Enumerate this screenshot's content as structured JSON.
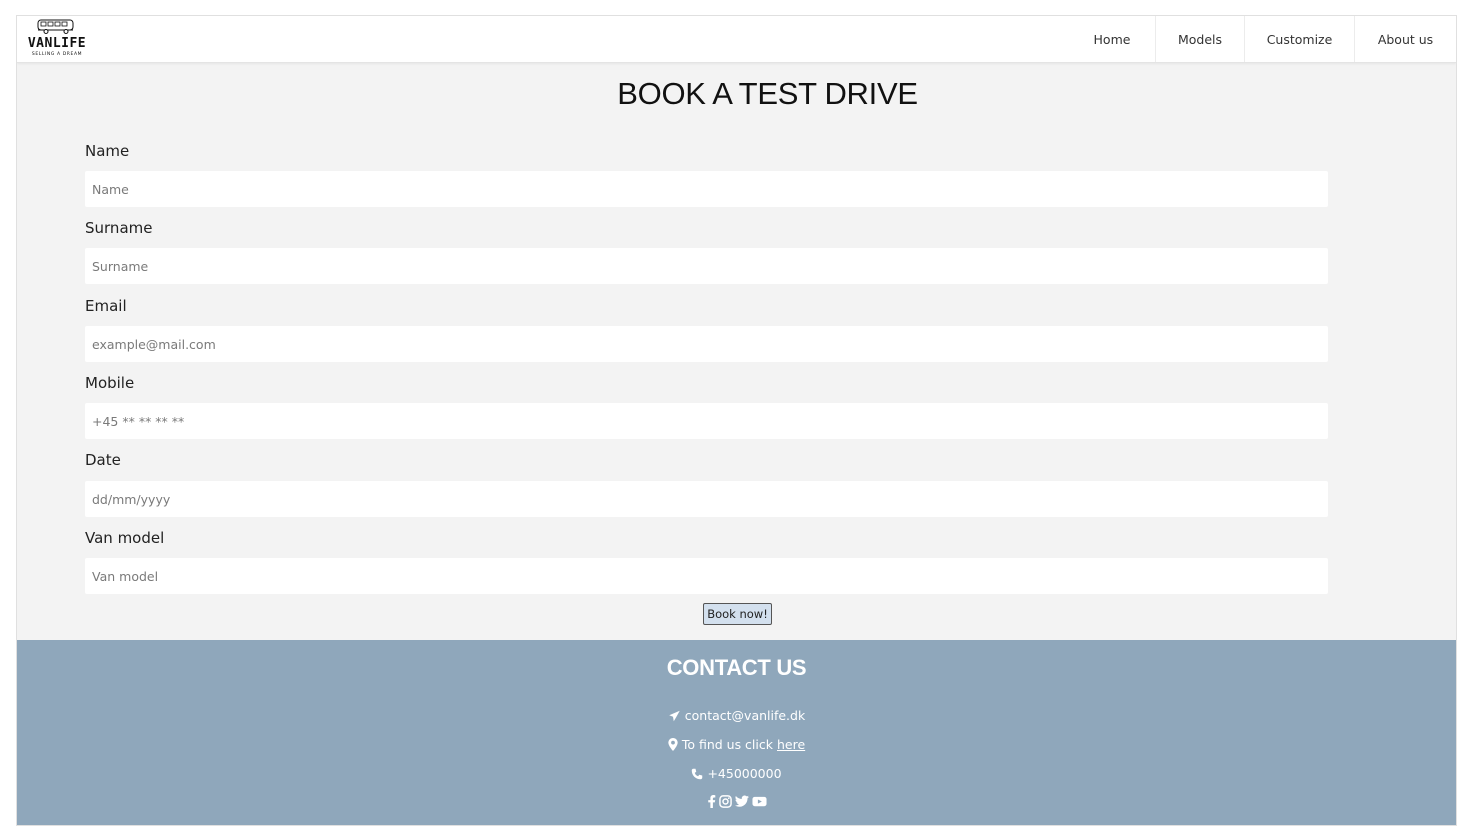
{
  "brand": {
    "name": "VANLIFE",
    "tagline": "SELLING A DREAM"
  },
  "nav": {
    "items": [
      {
        "label": "Home"
      },
      {
        "label": "Models"
      },
      {
        "label": "Customize"
      },
      {
        "label": "About us"
      }
    ]
  },
  "form": {
    "title": "BOOK A TEST DRIVE",
    "fields": [
      {
        "label": "Name",
        "placeholder": "Name"
      },
      {
        "label": "Surname",
        "placeholder": "Surname"
      },
      {
        "label": "Email",
        "placeholder": "example@mail.com"
      },
      {
        "label": "Mobile",
        "placeholder": "+45 ** ** ** **"
      },
      {
        "label": "Date",
        "placeholder": "dd/mm/yyyy"
      },
      {
        "label": "Van model",
        "placeholder": "Van model"
      }
    ],
    "submit_label": "Book now!"
  },
  "footer": {
    "title": "CONTACT US",
    "email": "contact@vanlife.dk",
    "find_prefix": "To find us click",
    "find_link": "here",
    "phone": "+45000000",
    "socials": [
      "facebook-icon",
      "instagram-icon",
      "twitter-icon",
      "youtube-icon"
    ]
  },
  "colors": {
    "footer_bg": "#8fa7bb",
    "page_bg": "#f3f3f3",
    "button_bg": "#d3e0ee"
  }
}
